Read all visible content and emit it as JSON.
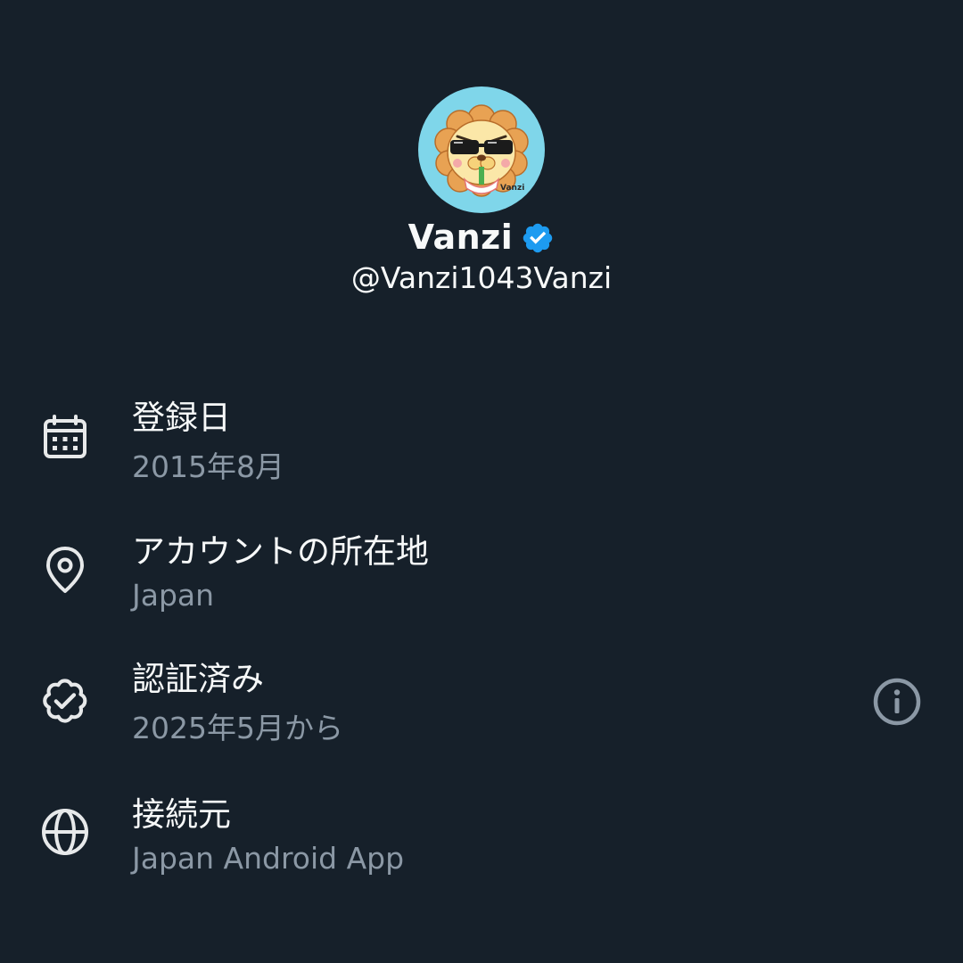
{
  "profile": {
    "display_name": "Vanzi",
    "handle": "@Vanzi1043Vanzi",
    "avatar_text": "Vanzi",
    "verified": true,
    "badge_color": "#1d9bf0"
  },
  "details": [
    {
      "icon": "calendar-icon",
      "title": "登録日",
      "value": "2015年8月"
    },
    {
      "icon": "location-pin-icon",
      "title": "アカウントの所在地",
      "value": "Japan"
    },
    {
      "icon": "verified-check-icon",
      "title": "認証済み",
      "value": "2025年5月から",
      "action_icon": "info-icon"
    },
    {
      "icon": "globe-icon",
      "title": "接続元",
      "value": "Japan Android App"
    }
  ],
  "colors": {
    "background": "#16202a",
    "primary_text": "#f7f9f9",
    "secondary_text": "#8b98a5",
    "icon": "#e7e9ea"
  }
}
